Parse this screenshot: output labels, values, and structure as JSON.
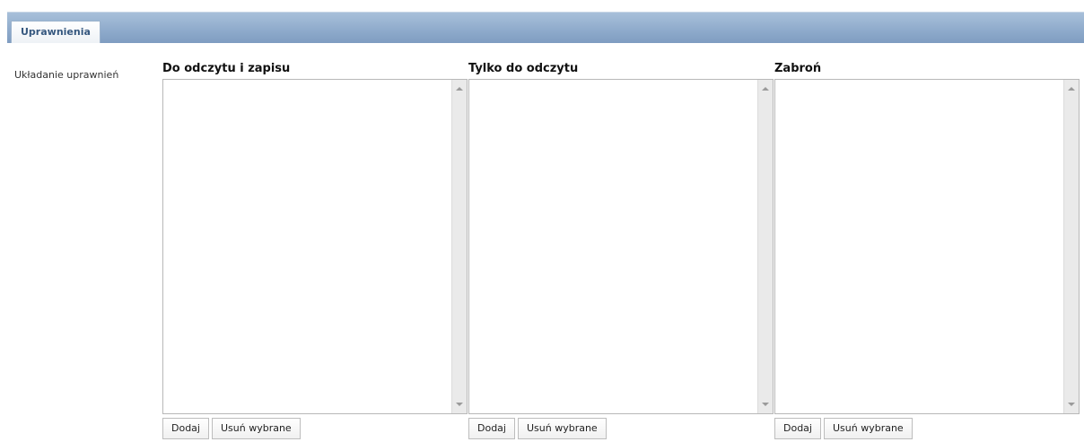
{
  "tabs": {
    "active_label": "Uprawnienia"
  },
  "section_label": "Układanie uprawnień",
  "columns": [
    {
      "title": "Do odczytu i zapisu",
      "add_label": "Dodaj",
      "remove_label": "Usuń wybrane"
    },
    {
      "title": "Tylko do odczytu",
      "add_label": "Dodaj",
      "remove_label": "Usuń wybrane"
    },
    {
      "title": "Zabroń",
      "add_label": "Dodaj",
      "remove_label": "Usuń wybrane"
    }
  ]
}
